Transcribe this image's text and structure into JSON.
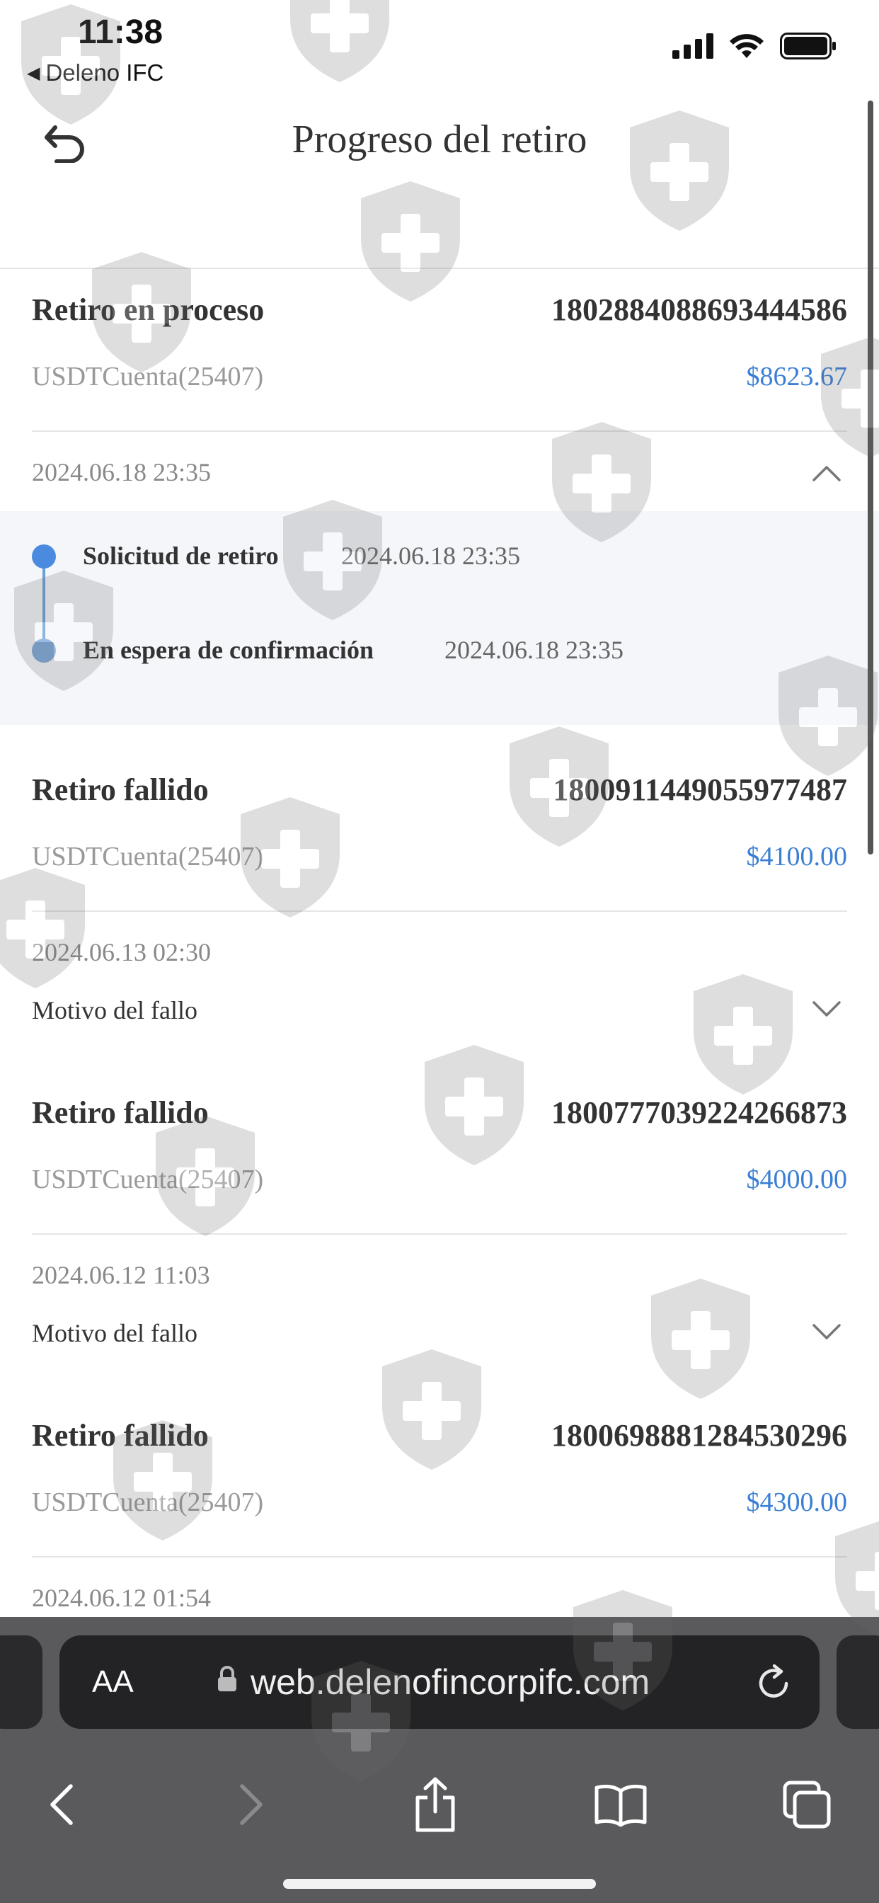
{
  "status_bar": {
    "time": "11:38",
    "back_app": "Deleno IFC"
  },
  "header": {
    "title": "Progreso del retiro"
  },
  "records": [
    {
      "status": "Retiro en proceso",
      "id": "1802884088693444586",
      "account": "USDTCuenta(25407)",
      "amount": "$8623.67",
      "date": "2024.06.18 23:35",
      "timeline": [
        {
          "label": "Solicitud de retiro",
          "time": "2024.06.18 23:35"
        },
        {
          "label": "En espera de confirmación",
          "time": "2024.06.18 23:35"
        }
      ]
    },
    {
      "status": "Retiro fallido",
      "id": "1800911449055977487",
      "account": "USDTCuenta(25407)",
      "amount": "$4100.00",
      "date": "2024.06.13 02:30",
      "reason_label": "Motivo del fallo"
    },
    {
      "status": "Retiro fallido",
      "id": "1800777039224266873",
      "account": "USDTCuenta(25407)",
      "amount": "$4000.00",
      "date": "2024.06.12 11:03",
      "reason_label": "Motivo del fallo"
    },
    {
      "status": "Retiro fallido",
      "id": "1800698881284530296",
      "account": "USDTCuenta(25407)",
      "amount": "$4300.00",
      "date": "2024.06.12 01:54"
    }
  ],
  "browser": {
    "aa_label": "AA",
    "url": "web.delenofincorpifc.com"
  },
  "colors": {
    "amount": "#3a7fd5",
    "timeline_bg": "#f4f6fa",
    "browser_bar": "#5a5a5c"
  },
  "icons": [
    "undo-back-icon",
    "chevron-up-icon",
    "chevron-down-icon",
    "lock-icon",
    "reload-icon",
    "back-arrow-icon",
    "forward-arrow-icon",
    "share-icon",
    "bookmarks-icon",
    "tabs-icon",
    "shield-watermark-icon"
  ]
}
